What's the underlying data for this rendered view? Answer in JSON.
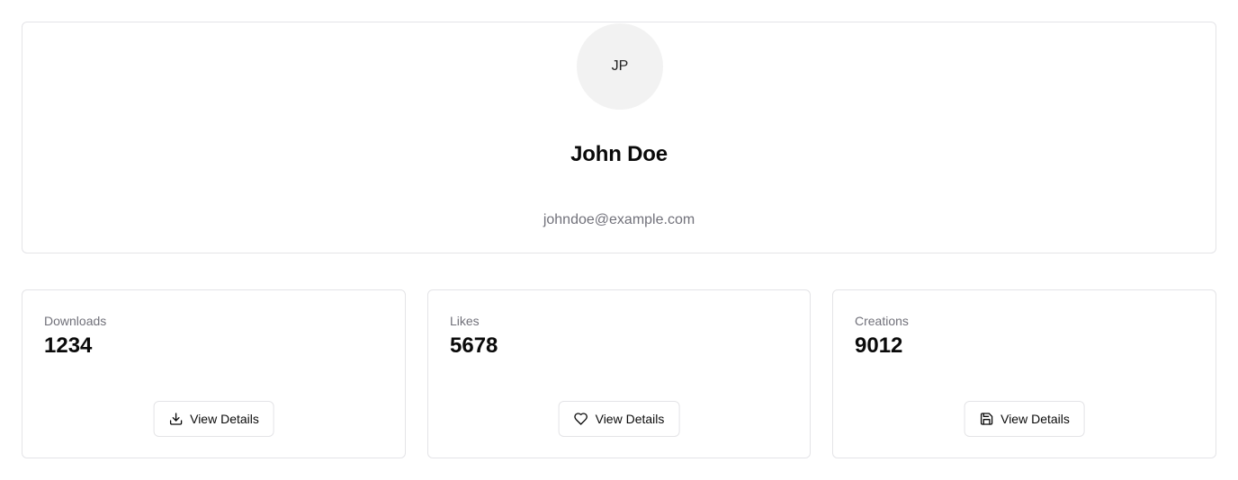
{
  "profile": {
    "initials": "JP",
    "name": "John Doe",
    "email": "johndoe@example.com"
  },
  "stats": [
    {
      "label": "Downloads",
      "value": "1234",
      "button_label": "View Details",
      "icon": "download-icon"
    },
    {
      "label": "Likes",
      "value": "5678",
      "button_label": "View Details",
      "icon": "heart-icon"
    },
    {
      "label": "Creations",
      "value": "9012",
      "button_label": "View Details",
      "icon": "save-icon"
    }
  ]
}
